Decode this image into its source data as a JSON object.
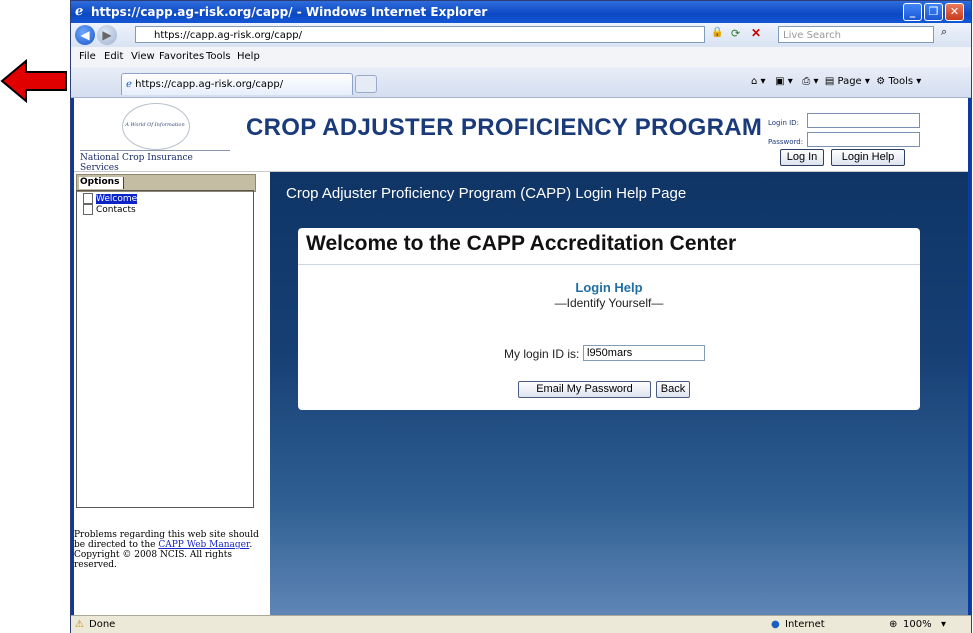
{
  "browser": {
    "window_title": "https://capp.ag-risk.org/capp/ - Windows Internet Explorer",
    "address": "https://capp.ag-risk.org/capp/",
    "search_placeholder": "Live Search",
    "menu": [
      "File",
      "Edit",
      "View",
      "Favorites",
      "Tools",
      "Help"
    ],
    "tab_label": "https://capp.ag-risk.org/capp/",
    "commands": {
      "page": "Page",
      "tools": "Tools"
    },
    "status_text": "Done",
    "zone": "Internet",
    "zoom": "100%"
  },
  "header": {
    "logo_tagline": "A World Of Information",
    "logo_org": "National Crop Insurance Services",
    "title": "CROP ADJUSTER PROFICIENCY PROGRAM",
    "login_id_label": "Login ID:",
    "password_label": "Password:",
    "login_button": "Log In",
    "login_help_button": "Login Help"
  },
  "sidebar": {
    "tab_label": "Options",
    "items": [
      "Welcome",
      "Contacts"
    ],
    "footer_pre": "Problems regarding this web site should be directed to the",
    "footer_link": "CAPP Web Manager",
    "footer_post": ". Copyright © 2008 NCIS. All rights reserved."
  },
  "main": {
    "page_title": "Crop Adjuster Proficiency Program (CAPP) Login Help Page",
    "card_title": "Welcome to the CAPP Accreditation Center",
    "section_title": "Login Help",
    "section_subtitle": "—Identify Yourself—",
    "login_id_label": "My login ID is:",
    "login_id_value": "l950mars",
    "email_button": "Email My Password",
    "back_button": "Back"
  },
  "colors": {
    "arrow": "#e00000",
    "title_blue": "#1a3a7a",
    "help_blue": "#1f6ea5"
  }
}
